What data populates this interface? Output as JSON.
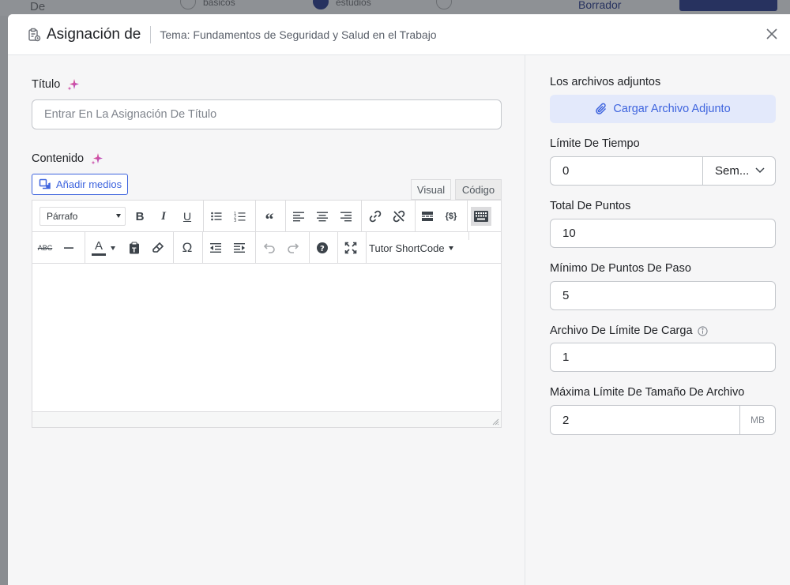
{
  "background": {
    "text_left": "De",
    "step1_label": "básicos",
    "step2_label": "estudios",
    "draft_label": "Borrador"
  },
  "header": {
    "title": "Asignación de",
    "subtitle": "Tema: Fundamentos de Seguridad y Salud en el Trabajo"
  },
  "left": {
    "title_label": "Título",
    "title_placeholder": "Entrar En La Asignación De Título",
    "content_label": "Contenido",
    "add_media": "Añadir medios",
    "tab_visual": "Visual",
    "tab_code": "Código",
    "format_select": "Párrafo",
    "shortcode": "Tutor ShortCode"
  },
  "right": {
    "attachments_label": "Los archivos adjuntos",
    "upload_button": "Cargar Archivo Adjunto",
    "time_limit_label": "Límite De Tiempo",
    "time_limit_value": "0",
    "time_limit_unit": "Sem...",
    "total_points_label": "Total De Puntos",
    "total_points_value": "10",
    "min_points_label": "Mínimo De Puntos De Paso",
    "min_points_value": "5",
    "upload_limit_label": "Archivo De Límite De Carga",
    "upload_limit_value": "1",
    "max_size_label": "Máxima Límite De Tamaño De Archivo",
    "max_size_value": "2",
    "max_size_unit": "MB"
  },
  "colors": {
    "accent": "#3e64de",
    "upload_bg": "#e3e9fb",
    "modal_bg": "#f6f6f7"
  }
}
